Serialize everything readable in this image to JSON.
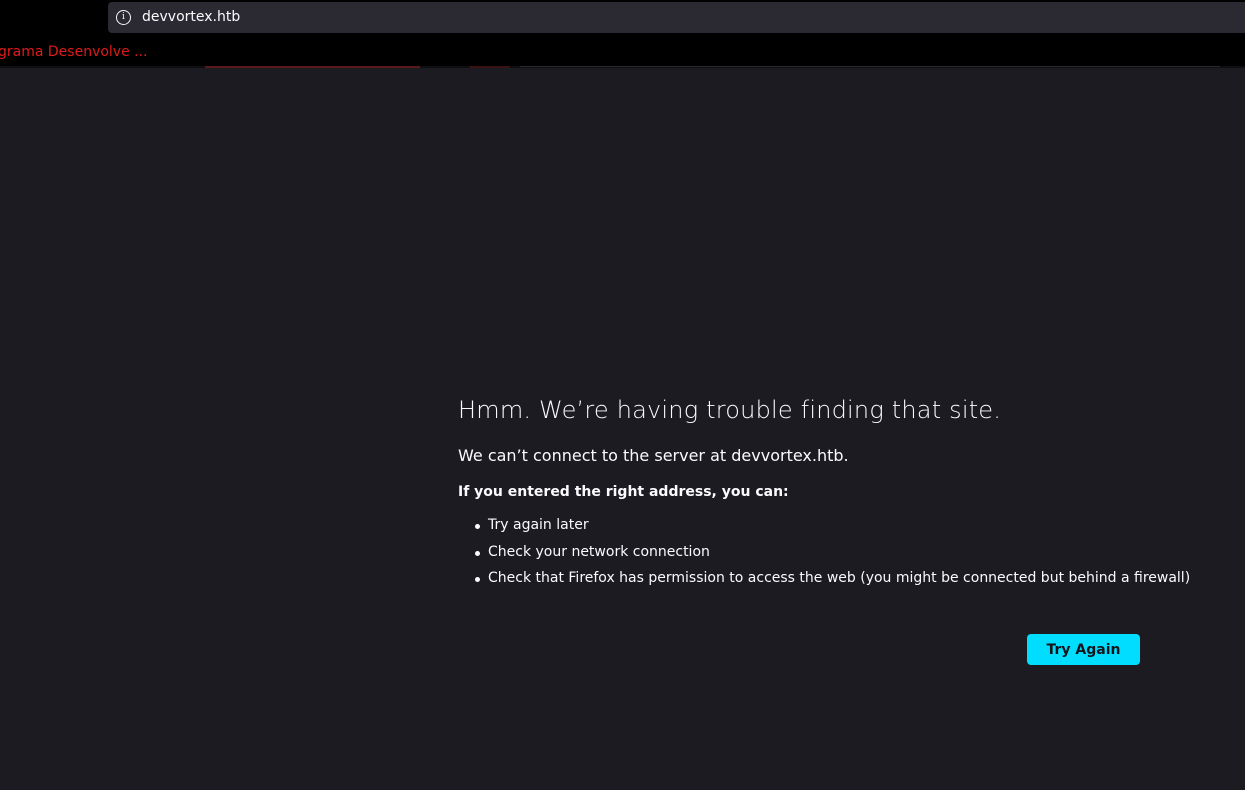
{
  "browser": {
    "url": "devvortex.htb",
    "bookmark_label": "grama Desenvolve ...",
    "info_icon": "info-icon"
  },
  "error_page": {
    "title": "Hmm. We’re having trouble finding that site.",
    "subtitle": "We can’t connect to the server at devvortex.htb.",
    "advice_heading": "If you entered the right address, you can:",
    "advice_items": [
      "Try again later",
      "Check your network connection",
      "Check that Firefox has permission to access the web (you might be connected but behind a firewall)"
    ],
    "try_again_label": "Try Again"
  },
  "colors": {
    "page_background": "#1c1b22",
    "toolbar_background": "#000000",
    "urlbar_background": "#2b2a33",
    "accent_button": "#00ddff",
    "bookmark_text": "#e01b1b",
    "text": "#fbfbfe"
  }
}
